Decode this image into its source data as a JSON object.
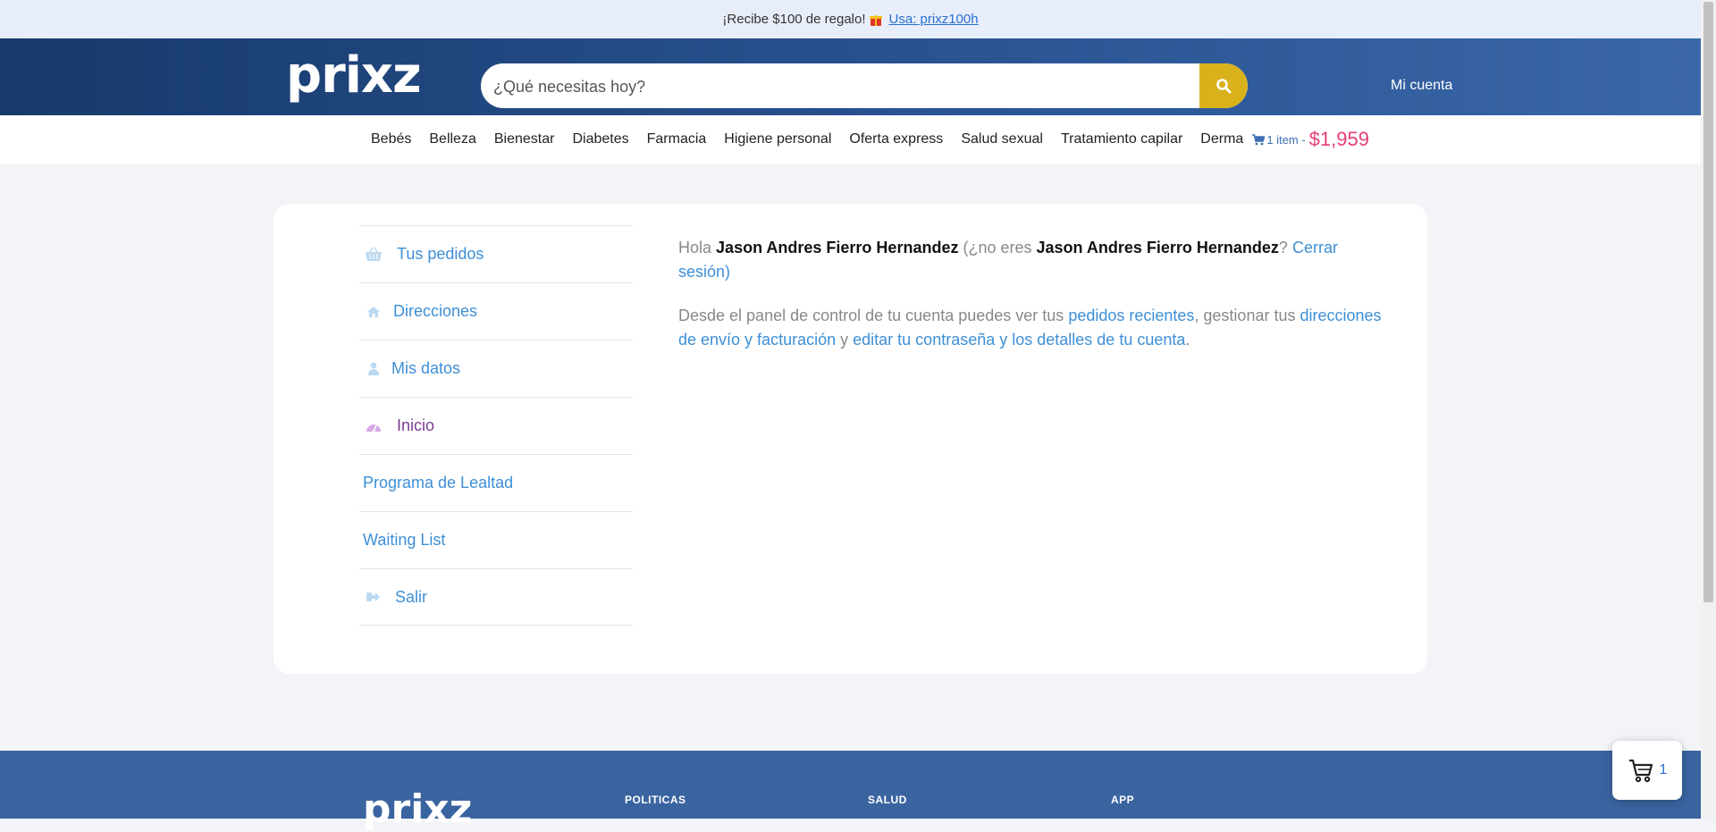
{
  "promo": {
    "text": "¡Recibe $100 de regalo!",
    "link": "Usa: prixz100h"
  },
  "header": {
    "logo": "prixz",
    "search_placeholder": "¿Qué necesitas hoy?",
    "account_label": "Mi cuenta"
  },
  "categories": [
    "Bebés",
    "Belleza",
    "Bienestar",
    "Diabetes",
    "Farmacia",
    "Higiene personal",
    "Oferta express",
    "Salud sexual",
    "Tratamiento capilar",
    "Derma"
  ],
  "cart_mini": {
    "items": "1 item -",
    "price": "$1,959"
  },
  "menu": [
    {
      "label": "Tus pedidos",
      "icon": "basket-icon"
    },
    {
      "label": "Direcciones",
      "icon": "home-icon"
    },
    {
      "label": "Mis datos",
      "icon": "user-icon"
    },
    {
      "label": "Inicio",
      "icon": "dashboard-icon"
    },
    {
      "label": "Programa de Lealtad",
      "icon": ""
    },
    {
      "label": "Waiting List",
      "icon": ""
    },
    {
      "label": "Salir",
      "icon": "logout-icon"
    }
  ],
  "welcome": {
    "hola": "Hola",
    "name": "Jason Andres Fierro Hernandez",
    "not_you_prefix": "(¿no eres",
    "not_you_name": "Jason Andres Fierro Hernandez",
    "qmark": "?",
    "logout": "Cerrar sesión)",
    "desc_1": "Desde el panel de control de tu cuenta puedes ver tus",
    "link_orders": "pedidos recientes",
    "desc_2": ", gestionar tus",
    "link_addresses": "direcciones de envío y facturación",
    "desc_3": "y",
    "link_password": "editar tu contraseña y los detalles de tu cuenta",
    "desc_4": "."
  },
  "footer": {
    "logo": "prixz",
    "headings": [
      "POLITICAS",
      "SALUD",
      "APP"
    ]
  },
  "floating_cart": {
    "count": "1"
  },
  "colors": {
    "header_dark": "#173a6b",
    "accent_yellow": "#d9b21b",
    "link_blue": "#3d8fd6",
    "price_pink": "#e53e72",
    "active_purple": "#7a3b8f",
    "footer_blue": "#3a64a0"
  }
}
